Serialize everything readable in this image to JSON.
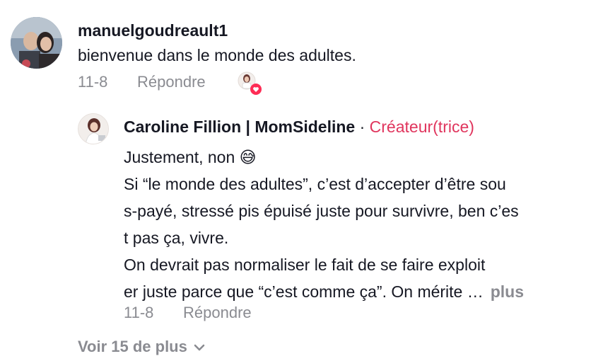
{
  "comment": {
    "username": "manuelgoudreault1",
    "text": "bienvenue dans le monde des adultes.",
    "date": "11-8",
    "reply_label": "Répondre",
    "liked_by_creator_icon": "creator-avatar-heart-icon"
  },
  "reply": {
    "author": "Caroline Fillion | MomSideline",
    "separator": "·",
    "badge": "Créateur(trice)",
    "lines": [
      "Justement, non 😅",
      "Si “le monde des adultes”, c’est d’accepter d’être sou",
      "s-payé, stressé pis épuisé juste pour survivre, ben c’es",
      "t pas ça, vivre.",
      "On devrait pas normaliser le fait de se faire exploit",
      "er juste parce que “c’est comme ça”. On mérite …"
    ],
    "more_label": "plus",
    "date": "11-8",
    "reply_label": "Répondre"
  },
  "view_more": {
    "label": "Voir 15 de plus",
    "icon": "chevron-down-icon"
  },
  "colors": {
    "text": "#161823",
    "muted": "#8a8b91",
    "creator_badge": "#e0355d",
    "heart": "#fe2c55"
  }
}
